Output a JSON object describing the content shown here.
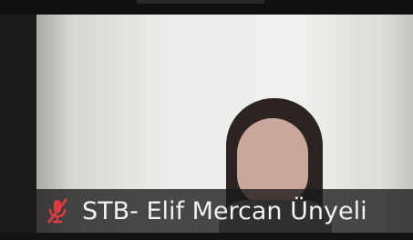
{
  "participant": {
    "name": "STB- Elif Mercan Ünyeli",
    "audio": "muted"
  },
  "icons": {
    "mic": "mic-muted-icon"
  },
  "colors": {
    "muted_icon": "#e0393e",
    "name_text": "#f2f2f2",
    "name_bar_bg": "#191919",
    "frame_bg": "#1a1a1a"
  }
}
